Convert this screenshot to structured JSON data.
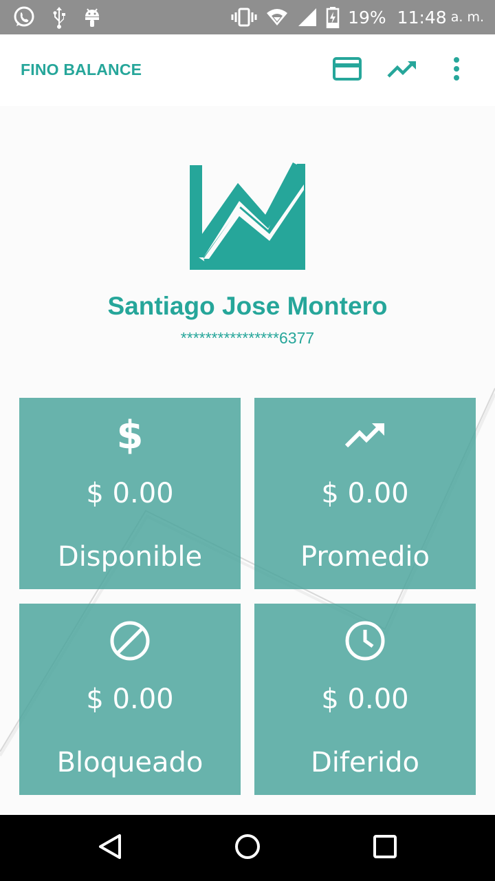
{
  "status_bar": {
    "battery_percent": "19%",
    "time": "11:48",
    "ampm": "a. m.",
    "icons": [
      "whatsapp-icon",
      "usb-icon",
      "android-icon",
      "vibrate-icon",
      "wifi-icon",
      "signal-icon",
      "battery-icon"
    ]
  },
  "app_bar": {
    "title": "FINO BALANCE",
    "actions": [
      "credit-card-icon",
      "trending-up-icon",
      "more-vert-icon"
    ]
  },
  "profile": {
    "name": "Santiago Jose Montero",
    "card_number": "****************6377"
  },
  "tiles": [
    {
      "icon": "dollar-icon",
      "amount": "$ 0.00",
      "label": "Disponible"
    },
    {
      "icon": "trending-up-icon",
      "amount": "$ 0.00",
      "label": "Promedio"
    },
    {
      "icon": "blocked-icon",
      "amount": "$ 0.00",
      "label": "Bloqueado"
    },
    {
      "icon": "clock-icon",
      "amount": "$ 0.00",
      "label": "Diferido"
    }
  ],
  "colors": {
    "accent": "#26a69a",
    "tile": "#4da69d",
    "status_bar": "#8f8f8f",
    "nav_bar": "#000000"
  }
}
